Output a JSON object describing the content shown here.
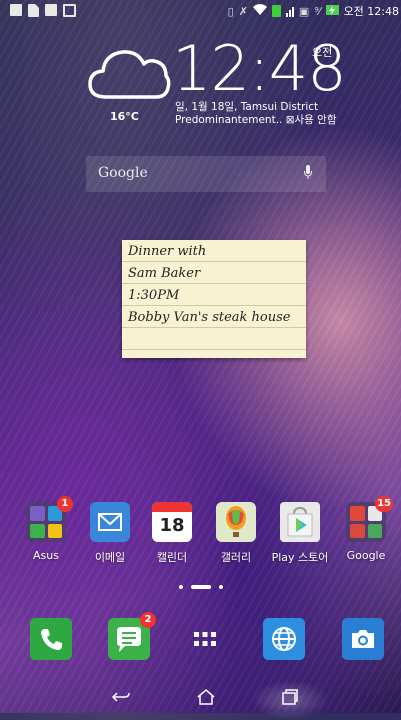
{
  "status_bar": {
    "left_icons": [
      "calendar-icon",
      "file-icon",
      "window-icon",
      "tablet-icon"
    ],
    "time": "오전 12:48"
  },
  "clock_widget": {
    "temperature": "16°C",
    "time": "12:48",
    "ampm": "오전",
    "date_location": "일, 1월 18일, Tamsui District",
    "weather_line": "Predominantement..  ⊠사용 안함"
  },
  "search": {
    "label": "Google"
  },
  "note": {
    "lines": [
      "Dinner with",
      "Sam Baker",
      "1:30PM",
      "Bobby Van's steak house"
    ]
  },
  "apps": [
    {
      "label": "Asus",
      "badge": "1"
    },
    {
      "label": "이메일"
    },
    {
      "label": "캘린더",
      "day": "18"
    },
    {
      "label": "갤러리"
    },
    {
      "label": "Play 스토어"
    },
    {
      "label": "Google",
      "badge": "15"
    }
  ],
  "dock": [
    {
      "name": "phone",
      "color": "#2fa843"
    },
    {
      "name": "messages",
      "color": "#3cb14a",
      "badge": "2"
    },
    {
      "name": "all-apps"
    },
    {
      "name": "browser",
      "color": "#2d8fe0"
    },
    {
      "name": "camera",
      "color": "#2a7fd4"
    }
  ]
}
